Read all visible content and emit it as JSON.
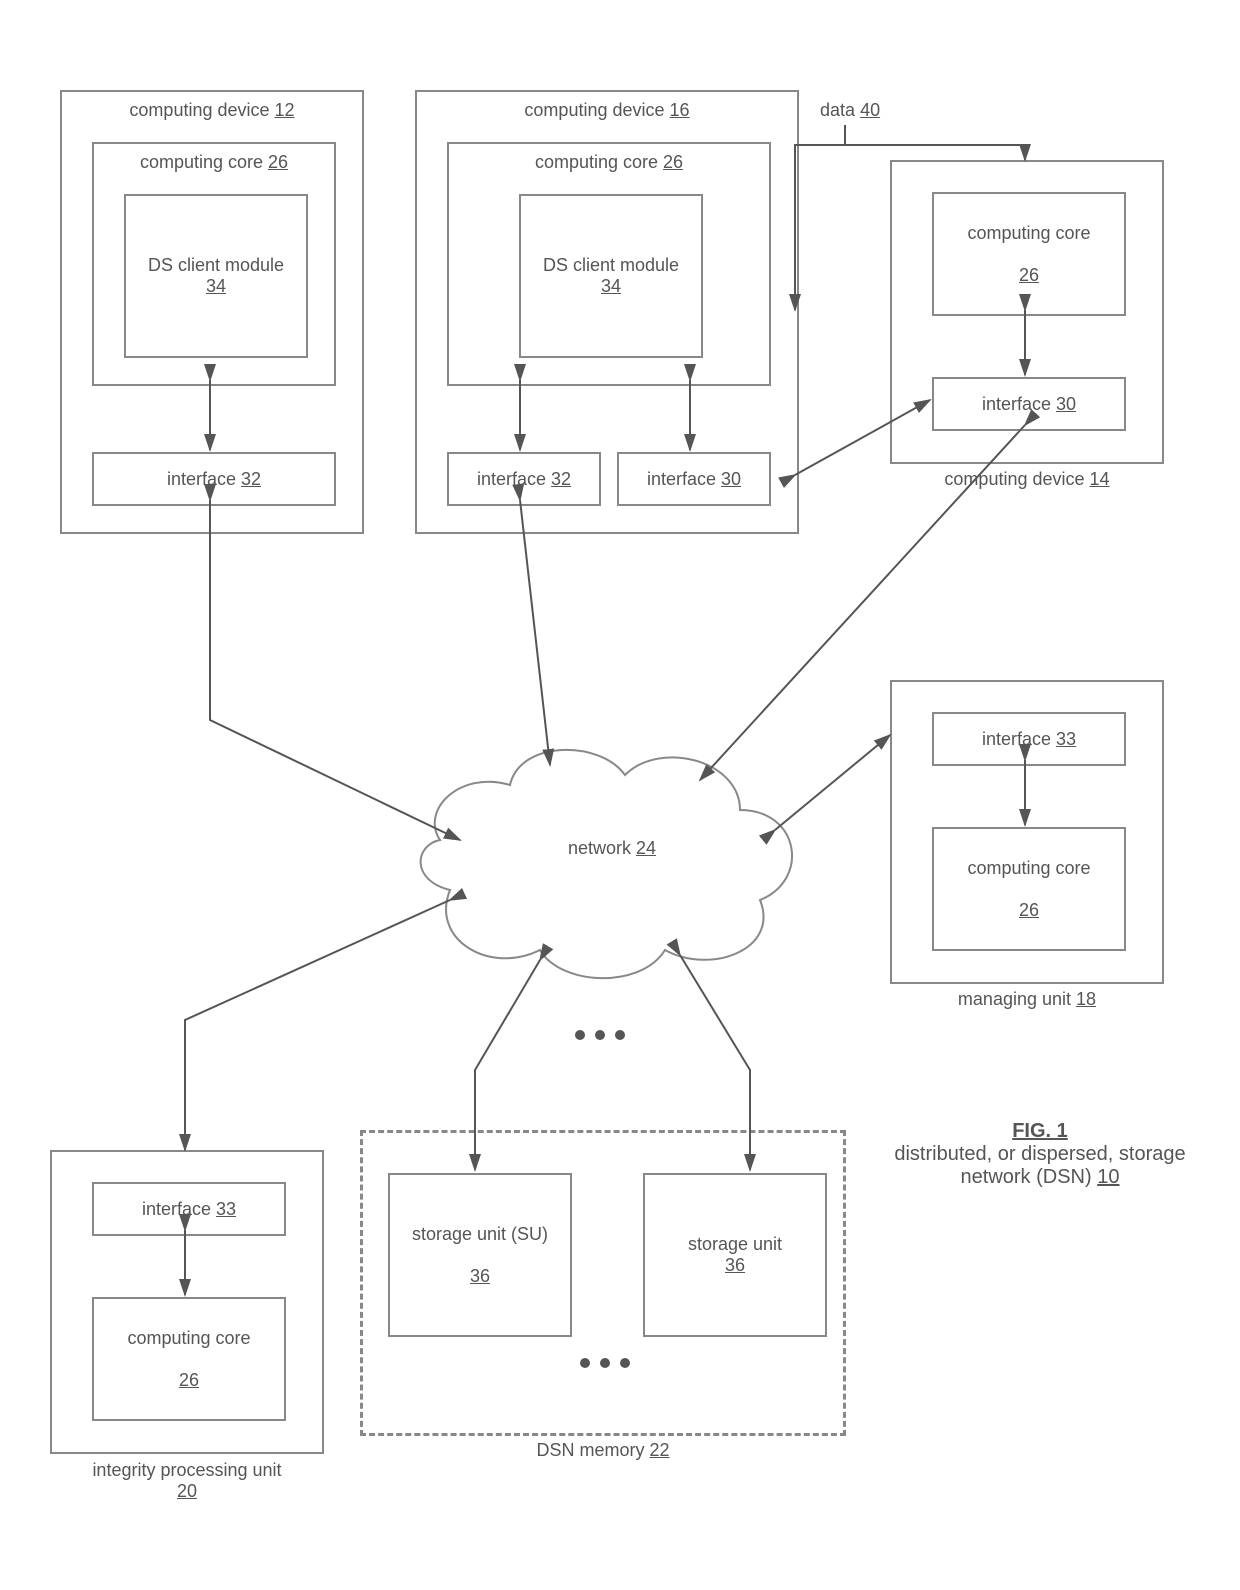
{
  "figure": {
    "title": "FIG. 1",
    "caption_line1": "distributed, or dispersed, storage",
    "caption_line2": "network (DSN)",
    "caption_ref": "10"
  },
  "data_label": "data",
  "data_ref": "40",
  "cd12": {
    "title": "computing device",
    "ref": "12",
    "core": "computing core",
    "core_ref": "26",
    "client": "DS client module",
    "client_ref": "34",
    "iface32": "interface",
    "iface32_ref": "32"
  },
  "cd16": {
    "title": "computing device",
    "ref": "16",
    "core": "computing core",
    "core_ref": "26",
    "client": "DS client module",
    "client_ref": "34",
    "iface32": "interface",
    "iface32_ref": "32",
    "iface30": "interface",
    "iface30_ref": "30"
  },
  "cd14": {
    "title": "computing device",
    "ref": "14",
    "core": "computing core",
    "core_ref": "26",
    "iface30": "interface",
    "iface30_ref": "30"
  },
  "network": {
    "label": "network",
    "ref": "24"
  },
  "integrity": {
    "title": "integrity processing unit",
    "ref": "20",
    "iface": "interface",
    "iface_ref": "33",
    "core": "computing core",
    "core_ref": "26"
  },
  "managing": {
    "title": "managing unit",
    "ref": "18",
    "iface": "interface",
    "iface_ref": "33",
    "core": "computing core",
    "core_ref": "26"
  },
  "memory": {
    "title": "DSN memory",
    "ref": "22",
    "su1": "storage unit (SU)",
    "su1_ref": "36",
    "su2": "storage unit",
    "su2_ref": "36"
  }
}
